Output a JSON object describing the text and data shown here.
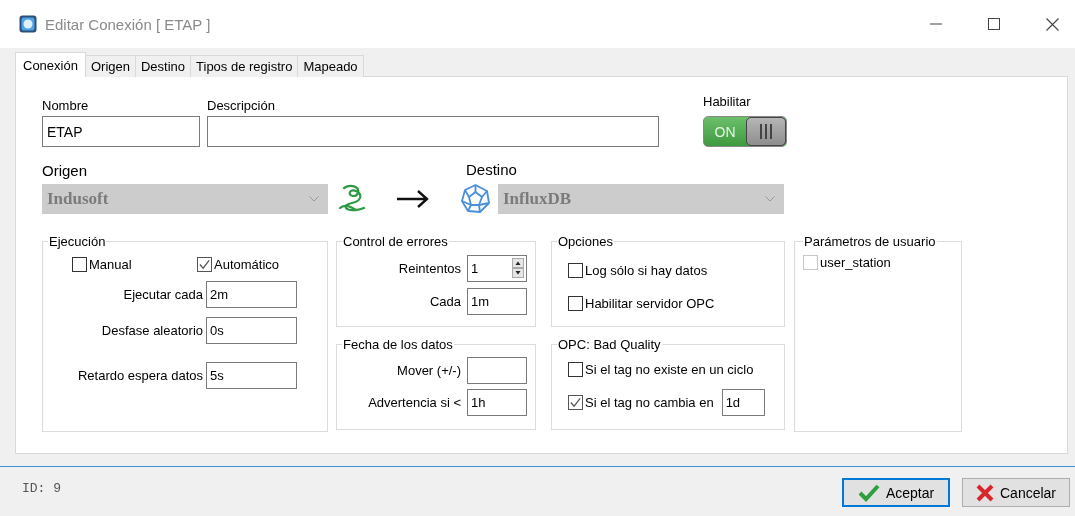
{
  "window": {
    "title": "Editar Conexión [ ETAP ]"
  },
  "tabs": [
    {
      "label": "Conexión",
      "selected": true
    },
    {
      "label": "Origen",
      "selected": false
    },
    {
      "label": "Destino",
      "selected": false
    },
    {
      "label": "Tipos de registro",
      "selected": false
    },
    {
      "label": "Mapeado",
      "selected": false
    }
  ],
  "general": {
    "name_label": "Nombre",
    "name_value": "ETAP",
    "description_label": "Descripción",
    "enable_label": "Habilitar",
    "enable_toggle": {
      "on": true,
      "text": "ON"
    }
  },
  "source": {
    "label": "Origen",
    "value": "Indusoft",
    "disabled": true
  },
  "destination": {
    "label": "Destino",
    "value": "InfluxDB",
    "disabled": true
  },
  "execution": {
    "title": "Ejecución",
    "modes": [
      {
        "label": "Manual",
        "checked": false
      },
      {
        "label": "Automático",
        "checked": true
      }
    ],
    "fields": [
      {
        "label": "Ejecutar cada",
        "value": "2m"
      },
      {
        "label": "Desfase aleatorio",
        "value": "0s"
      },
      {
        "label": "Retardo espera datos",
        "value": "5s"
      }
    ]
  },
  "error_control": {
    "title": "Control de errores",
    "fields": [
      {
        "kind": "spinner",
        "label": "Reintentos",
        "value": "1"
      },
      {
        "kind": "text",
        "label": "Cada",
        "value": "1m"
      }
    ]
  },
  "data_date": {
    "title": "Fecha de los datos",
    "fields": [
      {
        "label": "Mover (+/-)"
      },
      {
        "label": "Advertencia si <",
        "value": "1h"
      }
    ]
  },
  "options": {
    "title": "Opciones",
    "items": [
      {
        "label": "Log sólo si hay datos",
        "checked": false
      },
      {
        "label": "Habilitar servidor OPC",
        "checked": false
      }
    ]
  },
  "bad_quality": {
    "title": "OPC: Bad Quality",
    "items": [
      {
        "label": "Si el tag no existe en un ciclo",
        "checked": false
      },
      {
        "label": "Si el tag no cambia en",
        "checked": true,
        "value": "1d"
      }
    ]
  },
  "user_params": {
    "title": "Parámetros de usuario",
    "items": [
      {
        "label": "user_station",
        "checked": false
      }
    ]
  },
  "footer": {
    "id_text": "ID: 9",
    "buttons": [
      {
        "label": "Aceptar",
        "kind": "accept"
      },
      {
        "label": "Cancelar",
        "kind": "cancel"
      }
    ]
  }
}
